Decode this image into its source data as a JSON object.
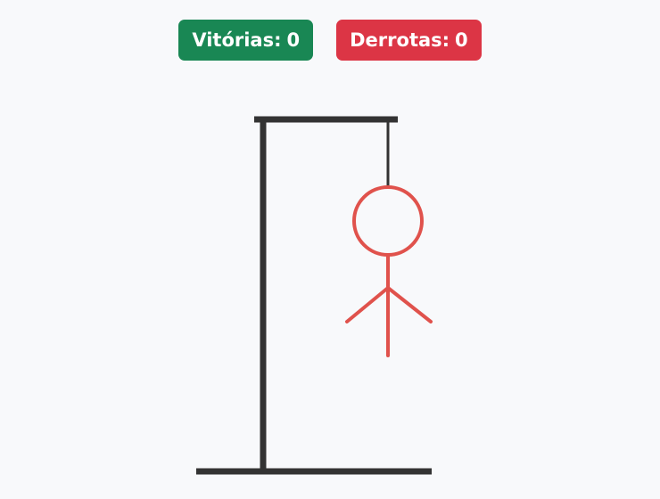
{
  "score": {
    "wins_label": "Vitórias:",
    "wins_value": "0",
    "losses_label": "Derrotas:",
    "losses_value": "0"
  },
  "colors": {
    "wins_badge": "#198754",
    "losses_badge": "#dc3545",
    "gallows": "#333333",
    "figure": "#e0524c"
  },
  "figure": {
    "parts_shown": [
      "head",
      "body",
      "left-arm",
      "right-arm"
    ],
    "parts_hidden": [
      "left-leg",
      "right-leg"
    ]
  }
}
